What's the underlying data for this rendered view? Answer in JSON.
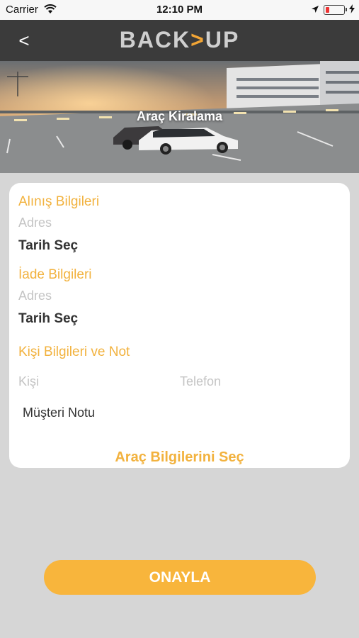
{
  "status_bar": {
    "carrier": "Carrier",
    "time": "12:10 PM"
  },
  "nav": {
    "back_label": "<",
    "logo_left": "BACK",
    "logo_arrow": ">",
    "logo_right": "UP"
  },
  "hero": {
    "title": "Araç Kiralama"
  },
  "form": {
    "pickup": {
      "title": "Alınış Bilgileri",
      "address_placeholder": "Adres",
      "date_label": "Tarih Seç"
    },
    "return": {
      "title": "İade Bilgileri",
      "address_placeholder": "Adres",
      "date_label": "Tarih Seç"
    },
    "person": {
      "title": "Kişi Bilgileri ve Not",
      "person_placeholder": "Kişi",
      "phone_placeholder": "Telefon",
      "note_placeholder": "Müşteri Notu"
    },
    "car_select_label": "Araç Bilgilerini Seç"
  },
  "confirm_label": "ONAYLA",
  "colors": {
    "accent": "#f2b23e",
    "button": "#f8b53c",
    "nav": "#3b3b3b",
    "background": "#d6d6d6"
  }
}
